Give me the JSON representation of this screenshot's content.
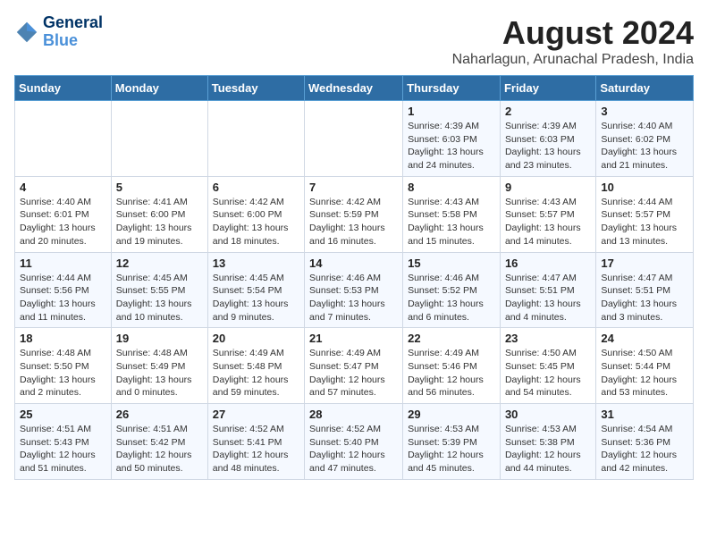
{
  "logo": {
    "text_general": "General",
    "text_blue": "Blue"
  },
  "title": "August 2024",
  "subtitle": "Naharlagun, Arunachal Pradesh, India",
  "weekdays": [
    "Sunday",
    "Monday",
    "Tuesday",
    "Wednesday",
    "Thursday",
    "Friday",
    "Saturday"
  ],
  "weeks": [
    [
      {
        "day": "",
        "info": ""
      },
      {
        "day": "",
        "info": ""
      },
      {
        "day": "",
        "info": ""
      },
      {
        "day": "",
        "info": ""
      },
      {
        "day": "1",
        "info": "Sunrise: 4:39 AM\nSunset: 6:03 PM\nDaylight: 13 hours\nand 24 minutes."
      },
      {
        "day": "2",
        "info": "Sunrise: 4:39 AM\nSunset: 6:03 PM\nDaylight: 13 hours\nand 23 minutes."
      },
      {
        "day": "3",
        "info": "Sunrise: 4:40 AM\nSunset: 6:02 PM\nDaylight: 13 hours\nand 21 minutes."
      }
    ],
    [
      {
        "day": "4",
        "info": "Sunrise: 4:40 AM\nSunset: 6:01 PM\nDaylight: 13 hours\nand 20 minutes."
      },
      {
        "day": "5",
        "info": "Sunrise: 4:41 AM\nSunset: 6:00 PM\nDaylight: 13 hours\nand 19 minutes."
      },
      {
        "day": "6",
        "info": "Sunrise: 4:42 AM\nSunset: 6:00 PM\nDaylight: 13 hours\nand 18 minutes."
      },
      {
        "day": "7",
        "info": "Sunrise: 4:42 AM\nSunset: 5:59 PM\nDaylight: 13 hours\nand 16 minutes."
      },
      {
        "day": "8",
        "info": "Sunrise: 4:43 AM\nSunset: 5:58 PM\nDaylight: 13 hours\nand 15 minutes."
      },
      {
        "day": "9",
        "info": "Sunrise: 4:43 AM\nSunset: 5:57 PM\nDaylight: 13 hours\nand 14 minutes."
      },
      {
        "day": "10",
        "info": "Sunrise: 4:44 AM\nSunset: 5:57 PM\nDaylight: 13 hours\nand 13 minutes."
      }
    ],
    [
      {
        "day": "11",
        "info": "Sunrise: 4:44 AM\nSunset: 5:56 PM\nDaylight: 13 hours\nand 11 minutes."
      },
      {
        "day": "12",
        "info": "Sunrise: 4:45 AM\nSunset: 5:55 PM\nDaylight: 13 hours\nand 10 minutes."
      },
      {
        "day": "13",
        "info": "Sunrise: 4:45 AM\nSunset: 5:54 PM\nDaylight: 13 hours\nand 9 minutes."
      },
      {
        "day": "14",
        "info": "Sunrise: 4:46 AM\nSunset: 5:53 PM\nDaylight: 13 hours\nand 7 minutes."
      },
      {
        "day": "15",
        "info": "Sunrise: 4:46 AM\nSunset: 5:52 PM\nDaylight: 13 hours\nand 6 minutes."
      },
      {
        "day": "16",
        "info": "Sunrise: 4:47 AM\nSunset: 5:51 PM\nDaylight: 13 hours\nand 4 minutes."
      },
      {
        "day": "17",
        "info": "Sunrise: 4:47 AM\nSunset: 5:51 PM\nDaylight: 13 hours\nand 3 minutes."
      }
    ],
    [
      {
        "day": "18",
        "info": "Sunrise: 4:48 AM\nSunset: 5:50 PM\nDaylight: 13 hours\nand 2 minutes."
      },
      {
        "day": "19",
        "info": "Sunrise: 4:48 AM\nSunset: 5:49 PM\nDaylight: 13 hours\nand 0 minutes."
      },
      {
        "day": "20",
        "info": "Sunrise: 4:49 AM\nSunset: 5:48 PM\nDaylight: 12 hours\nand 59 minutes."
      },
      {
        "day": "21",
        "info": "Sunrise: 4:49 AM\nSunset: 5:47 PM\nDaylight: 12 hours\nand 57 minutes."
      },
      {
        "day": "22",
        "info": "Sunrise: 4:49 AM\nSunset: 5:46 PM\nDaylight: 12 hours\nand 56 minutes."
      },
      {
        "day": "23",
        "info": "Sunrise: 4:50 AM\nSunset: 5:45 PM\nDaylight: 12 hours\nand 54 minutes."
      },
      {
        "day": "24",
        "info": "Sunrise: 4:50 AM\nSunset: 5:44 PM\nDaylight: 12 hours\nand 53 minutes."
      }
    ],
    [
      {
        "day": "25",
        "info": "Sunrise: 4:51 AM\nSunset: 5:43 PM\nDaylight: 12 hours\nand 51 minutes."
      },
      {
        "day": "26",
        "info": "Sunrise: 4:51 AM\nSunset: 5:42 PM\nDaylight: 12 hours\nand 50 minutes."
      },
      {
        "day": "27",
        "info": "Sunrise: 4:52 AM\nSunset: 5:41 PM\nDaylight: 12 hours\nand 48 minutes."
      },
      {
        "day": "28",
        "info": "Sunrise: 4:52 AM\nSunset: 5:40 PM\nDaylight: 12 hours\nand 47 minutes."
      },
      {
        "day": "29",
        "info": "Sunrise: 4:53 AM\nSunset: 5:39 PM\nDaylight: 12 hours\nand 45 minutes."
      },
      {
        "day": "30",
        "info": "Sunrise: 4:53 AM\nSunset: 5:38 PM\nDaylight: 12 hours\nand 44 minutes."
      },
      {
        "day": "31",
        "info": "Sunrise: 4:54 AM\nSunset: 5:36 PM\nDaylight: 12 hours\nand 42 minutes."
      }
    ]
  ]
}
